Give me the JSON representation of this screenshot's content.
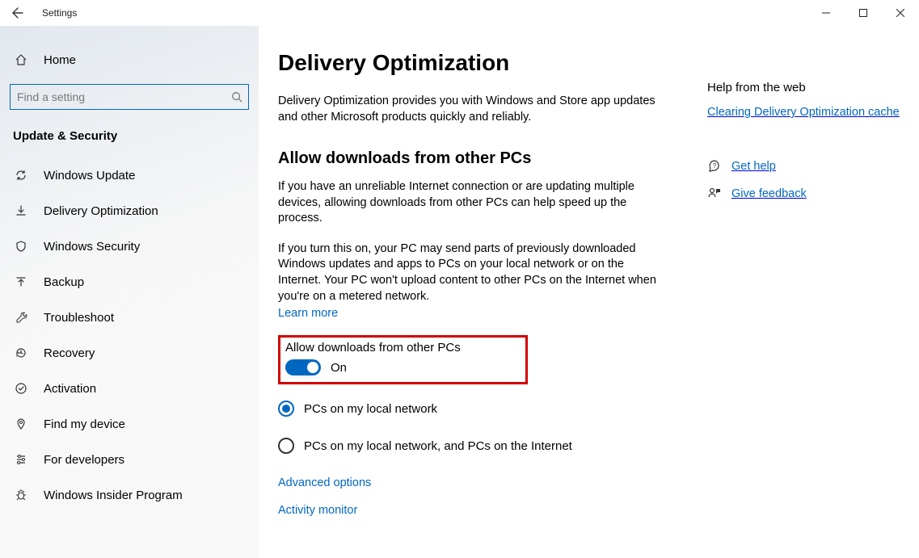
{
  "window": {
    "title": "Settings"
  },
  "nav": {
    "home": "Home",
    "search_placeholder": "Find a setting",
    "category": "Update & Security",
    "items": [
      {
        "label": "Windows Update"
      },
      {
        "label": "Delivery Optimization"
      },
      {
        "label": "Windows Security"
      },
      {
        "label": "Backup"
      },
      {
        "label": "Troubleshoot"
      },
      {
        "label": "Recovery"
      },
      {
        "label": "Activation"
      },
      {
        "label": "Find my device"
      },
      {
        "label": "For developers"
      },
      {
        "label": "Windows Insider Program"
      }
    ]
  },
  "main": {
    "title": "Delivery Optimization",
    "intro": "Delivery Optimization provides you with Windows and Store app updates and other Microsoft products quickly and reliably.",
    "allow_section_title": "Allow downloads from other PCs",
    "allow_para1": "If you have an unreliable Internet connection or are updating multiple devices, allowing downloads from other PCs can help speed up the process.",
    "allow_para2": "If you turn this on, your PC may send parts of previously downloaded Windows updates and apps to PCs on your local network or on the Internet. Your PC won't upload content to other PCs on the Internet when you're on a metered network.",
    "learn_more": "Learn more",
    "toggle_label": "Allow downloads from other PCs",
    "toggle_state": "On",
    "radio1": "PCs on my local network",
    "radio2": "PCs on my local network, and PCs on the Internet",
    "advanced": "Advanced options",
    "activity": "Activity monitor"
  },
  "rail": {
    "help_title": "Help from the web",
    "help_link": "Clearing Delivery Optimization cache",
    "get_help": "Get help",
    "feedback": "Give feedback"
  }
}
